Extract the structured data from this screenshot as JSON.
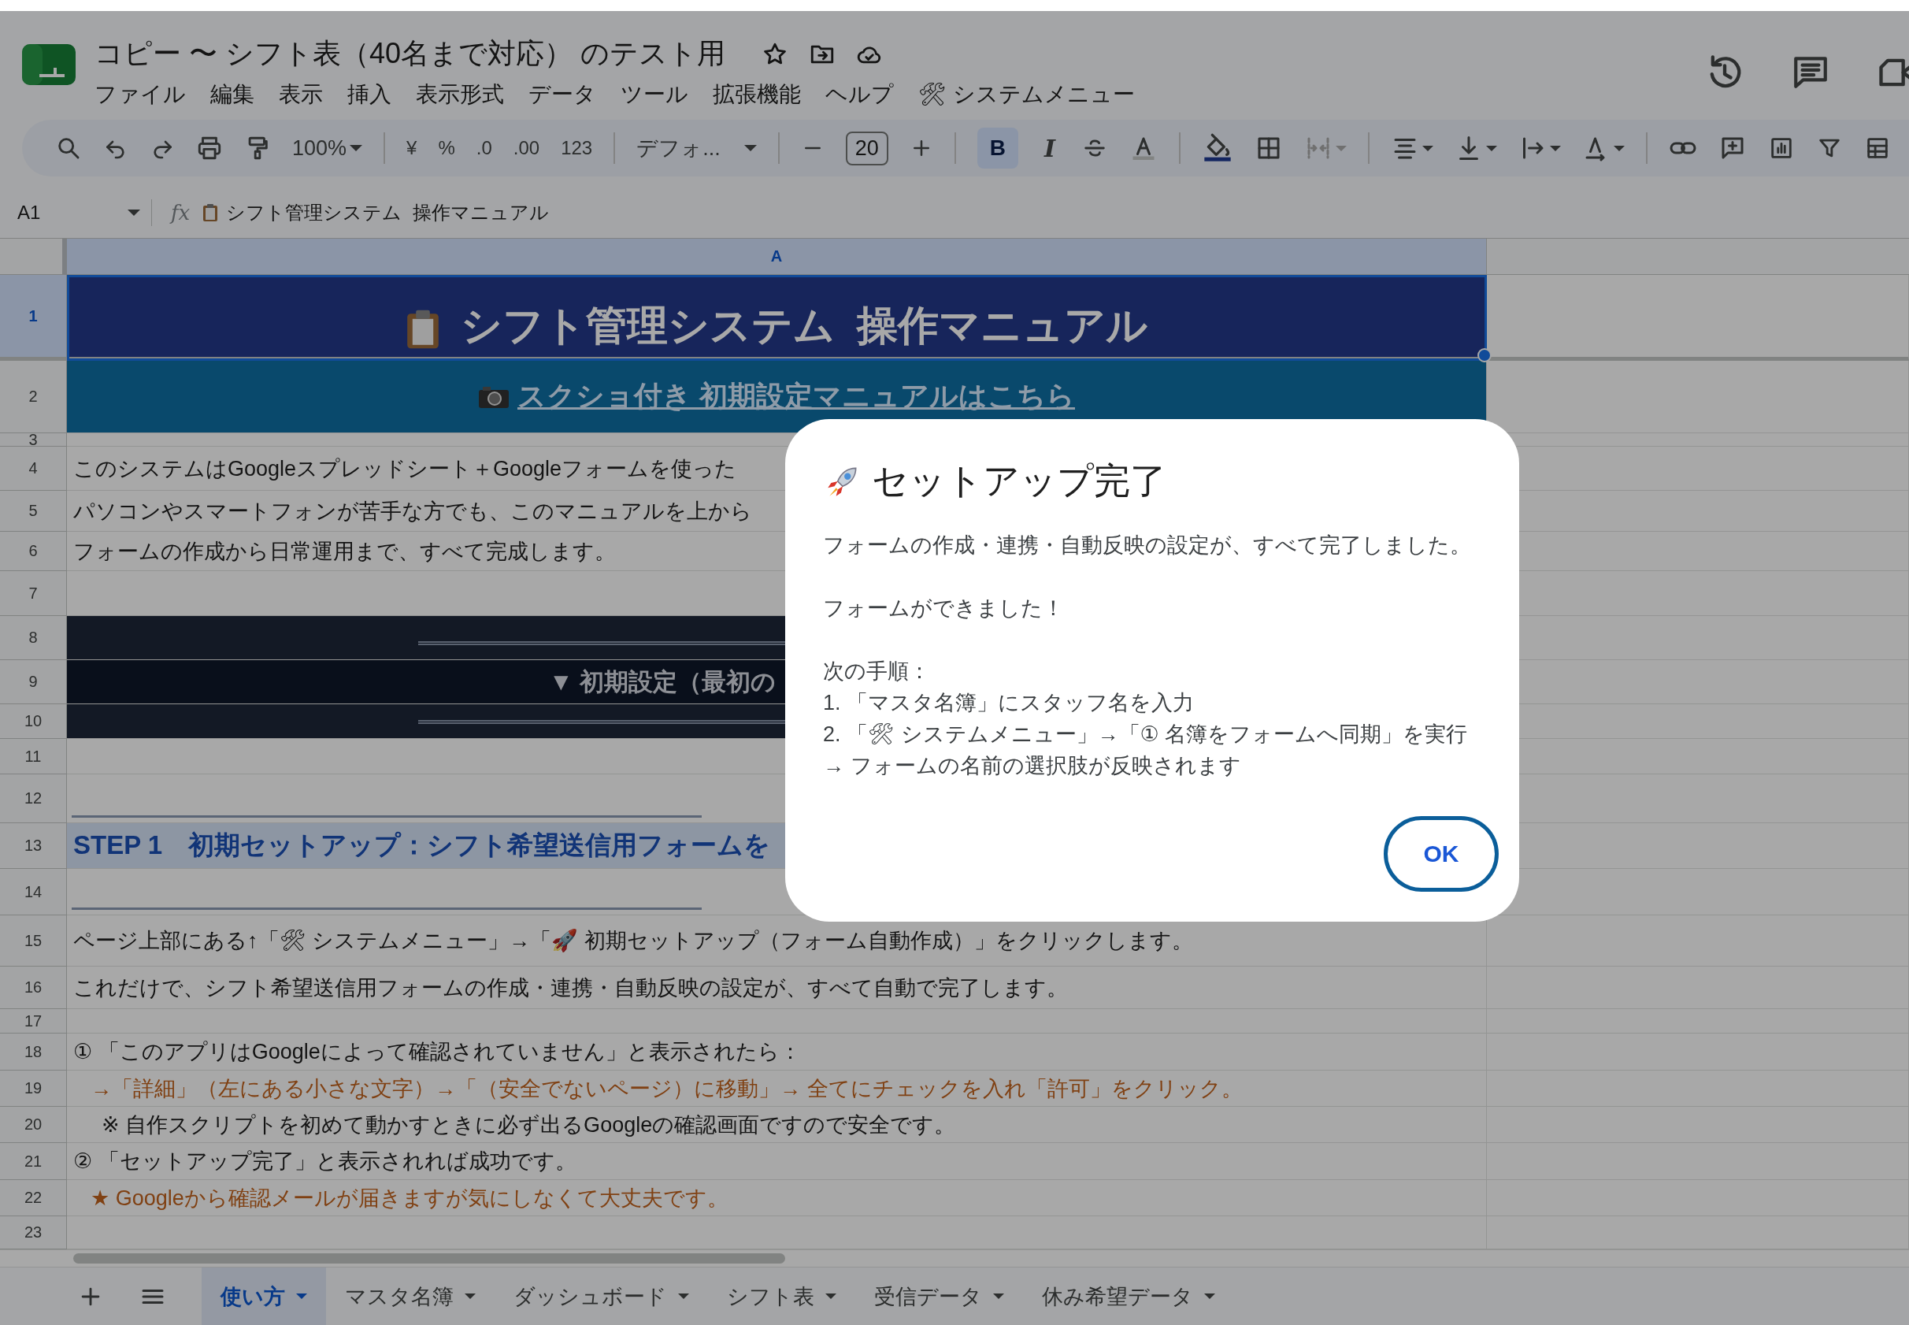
{
  "document": {
    "title": "コピー 〜 シフト表（40名まで対応） のテスト用"
  },
  "menu": [
    "ファイル",
    "編集",
    "表示",
    "挿入",
    "表示形式",
    "データ",
    "ツール",
    "拡張機能",
    "ヘルプ",
    "🛠 システムメニュー"
  ],
  "toolbar": {
    "zoom": "100%",
    "currency": "¥",
    "percent": "%",
    "decimal_decrease": ".0",
    "decimal_increase": ".00",
    "number_format": "123",
    "font": "デフォ...",
    "font_size": "20",
    "bold": {
      "label": "B",
      "on": true
    },
    "italic": {
      "label": "I",
      "on": false
    },
    "merge_disabled": true
  },
  "formula_bar": {
    "cell": "A1",
    "fx": "fx",
    "content": "シフト管理システム  操作マニュアル"
  },
  "sheet": {
    "columns": [
      {
        "label": "A",
        "selected": true
      }
    ],
    "rows": [
      {
        "number": "1",
        "selected": true,
        "kind": "title",
        "text": "シフト管理システム  操作マニュアル"
      },
      {
        "number": "2",
        "selected": false,
        "kind": "link",
        "text": "スクショ付き 初期設定マニュアルはこちら"
      },
      {
        "number": "3",
        "selected": false,
        "kind": "blank"
      },
      {
        "number": "4",
        "selected": false,
        "kind": "text",
        "text": "このシステムはGoogleスプレッドシート＋Googleフォームを使った"
      },
      {
        "number": "5",
        "selected": false,
        "kind": "text",
        "text": "パソコンやスマートフォンが苦手な方でも、このマニュアルを上から"
      },
      {
        "number": "6",
        "selected": false,
        "kind": "text",
        "text": "フォームの作成から日常運用まで、すべて完成します。"
      },
      {
        "number": "7",
        "selected": false,
        "kind": "blank"
      },
      {
        "number": "8",
        "selected": false,
        "kind": "band"
      },
      {
        "number": "9",
        "selected": false,
        "kind": "section",
        "text": "▼ 初期設定（最初の"
      },
      {
        "number": "10",
        "selected": false,
        "kind": "band"
      },
      {
        "number": "11",
        "selected": false,
        "kind": "blank"
      },
      {
        "number": "12",
        "selected": false,
        "kind": "rule"
      },
      {
        "number": "13",
        "selected": false,
        "kind": "step",
        "text": "STEP 1　初期セットアップ：シフト希望送信用フォームを"
      },
      {
        "number": "14",
        "selected": false,
        "kind": "rule"
      },
      {
        "number": "15",
        "selected": false,
        "kind": "text",
        "text": "ページ上部にある↑「🛠 システムメニュー」→「🚀 初期セットアップ（フォーム自動作成）」をクリックします。"
      },
      {
        "number": "16",
        "selected": false,
        "kind": "text",
        "text": "これだけで、シフト希望送信用フォームの作成・連携・自動反映の設定が、すべて自動で完了します。"
      },
      {
        "number": "17",
        "selected": false,
        "kind": "blank"
      },
      {
        "number": "18",
        "selected": false,
        "kind": "text",
        "text": "① 「このアプリはGoogleによって確認されていません」と表示されたら："
      },
      {
        "number": "19",
        "selected": false,
        "kind": "note",
        "text": "→「詳細」（左にある小さな文字）→「（安全でないページ）に移動」→ 全てにチェックを入れ「許可」をクリック。"
      },
      {
        "number": "20",
        "selected": false,
        "kind": "indented",
        "text": "※ 自作スクリプトを初めて動かすときに必ず出るGoogleの確認画面ですので安全です。"
      },
      {
        "number": "21",
        "selected": false,
        "kind": "text",
        "text": "② 「セットアップ完了」と表示されれば成功です。"
      },
      {
        "number": "22",
        "selected": false,
        "kind": "note",
        "text": "★ Googleから確認メールが届きますが気にしなくて大丈夫です。"
      },
      {
        "number": "23",
        "selected": false,
        "kind": "blank"
      }
    ]
  },
  "dialog": {
    "title": "セットアップ完了",
    "paragraphs": [
      [
        "フォームの作成・連携・自動反映の設定が、すべて完了しました。"
      ],
      [
        "フォームができました！"
      ],
      [
        "次の手順：",
        "1. 「マスタ名簿」にスタッフ名を入力",
        "2. 「🛠 システムメニュー」→「① 名簿をフォームへ同期」を実行",
        "→ フォームの名前の選択肢が反映されます"
      ]
    ],
    "button": "OK"
  },
  "sheet_tabs": [
    {
      "label": "使い方",
      "selected": true
    },
    {
      "label": "マスタ名簿",
      "selected": false
    },
    {
      "label": "ダッシュボード",
      "selected": false
    },
    {
      "label": "シフト表",
      "selected": false
    },
    {
      "label": "受信データ",
      "selected": false
    },
    {
      "label": "休み希望データ",
      "selected": false
    }
  ]
}
